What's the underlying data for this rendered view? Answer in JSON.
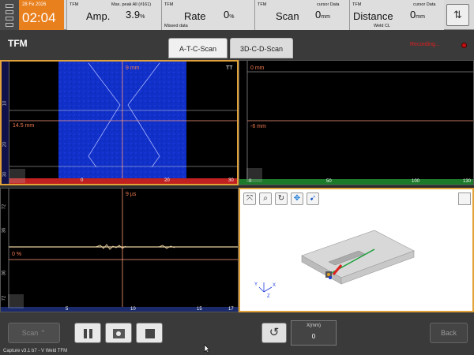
{
  "clock": {
    "date": "28 Fe 2026",
    "time": "02:04"
  },
  "status": {
    "amp": {
      "tag": "TFM",
      "caption": "Max. peak All (#161)",
      "label": "Amp.",
      "value": "3.9",
      "unit": "%"
    },
    "rate": {
      "tag": "TFM",
      "caption": "Missed data",
      "label": "Rate",
      "value": "0",
      "unit": "%"
    },
    "scan": {
      "tag": "TFM",
      "caption": "cursor Data",
      "label": "Scan",
      "value": "0",
      "unit": "mm"
    },
    "distance": {
      "tag": "TFM",
      "caption": "cursor Data",
      "sub": "Weld CL",
      "label": "Distance",
      "value": "0",
      "unit": "mm"
    }
  },
  "header": {
    "title": "TFM",
    "tabs": [
      {
        "label": "A-T-C-Scan"
      },
      {
        "label": "3D-C-D-Scan"
      }
    ],
    "recording": "Recording..."
  },
  "views": {
    "tl": {
      "mode": "TT",
      "cursor_top": "9 mm",
      "cursor_depth": "14.5 mm",
      "y_ticks": [
        "10",
        "20",
        "30"
      ],
      "x_ticks": [
        "0",
        "20",
        "30"
      ]
    },
    "tr": {
      "cursor_top": "0 mm",
      "cursor_depth": "-6 mm",
      "x_ticks": [
        "0",
        "50",
        "100",
        "130"
      ]
    },
    "bl": {
      "cursor_time": "9 µs",
      "amp_level": "0 %",
      "y_ticks": [
        "72",
        "36",
        "36",
        "72"
      ],
      "x_ticks": [
        "5",
        "10",
        "15",
        "17"
      ]
    }
  },
  "toolbar3d": {
    "icons": [
      "fit-icon",
      "zoom-icon",
      "rotate-icon",
      "pan-icon",
      "probe-icon"
    ]
  },
  "bottom": {
    "scan_label": "Scan ⌃",
    "x_label": "X(mm)",
    "x_value": "0",
    "back_label": "Back"
  },
  "footer": "Capture v3.1 b7 - V Weld TFM"
}
